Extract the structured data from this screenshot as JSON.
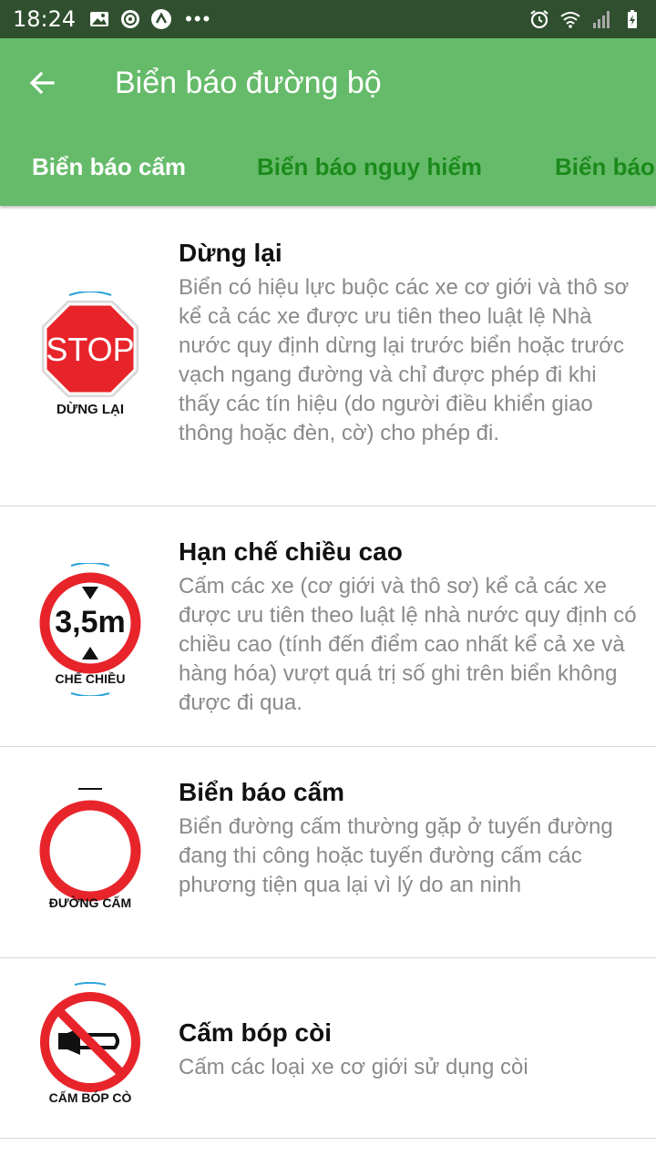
{
  "status_bar": {
    "time": "18:24",
    "left_icons": [
      "image-icon",
      "sync-icon",
      "app-icon",
      "more-icon"
    ],
    "right_icons": [
      "alarm-icon",
      "wifi-icon",
      "signal-icon",
      "battery-icon"
    ]
  },
  "app_bar": {
    "title": "Biển báo đường bộ",
    "back_icon": "back-arrow-icon"
  },
  "tabs": [
    {
      "label": "Biển báo cấm",
      "active": true
    },
    {
      "label": "Biển báo nguy hiểm",
      "active": false
    },
    {
      "label": "Biển báo",
      "active": false
    }
  ],
  "items": [
    {
      "title": "Dừng lại",
      "desc": "Biển có hiệu lực buộc các xe cơ giới và thô sơ kể cả các xe được ưu tiên theo luật lệ Nhà nước quy định dừng lại trước biển hoặc trước vạch ngang đường và chỉ được phép đi khi thấy các tín hiệu (do người điều khiển giao thông hoặc đèn, cờ) cho phép đi.",
      "icon": "stop-sign-icon",
      "sign_text": "STOP",
      "caption": "DỪNG LẠI"
    },
    {
      "title": "Hạn chế chiều cao",
      "desc": "Cấm các xe (cơ giới và thô sơ) kể cả các xe được ưu tiên theo luật lệ nhà nước quy định có chiều cao (tính đến điểm cao nhất kể cả xe và hàng hóa) vượt quá trị số ghi trên biển không được đi qua.",
      "icon": "height-limit-sign-icon",
      "sign_text": "3,5m",
      "caption": "CHẾ CHIỀU"
    },
    {
      "title": "Biển báo cấm",
      "desc": "Biển đường cấm thường gặp ở tuyến đường đang thi công hoặc tuyến đường cấm các phương tiện qua lại vì lý do an ninh",
      "icon": "no-entry-sign-icon",
      "caption": "ĐƯỜNG CẤM"
    },
    {
      "title": "Cấm bóp còi",
      "desc": "Cấm các loại xe cơ giới sử dụng còi",
      "icon": "no-horn-sign-icon",
      "caption": "CẤM BÓP CÒ"
    }
  ],
  "colors": {
    "status_bar": "#2f4f2f",
    "app_bar": "#66bb6a",
    "tab_inactive": "#1b8a1b",
    "sign_red": "#e8242b"
  }
}
